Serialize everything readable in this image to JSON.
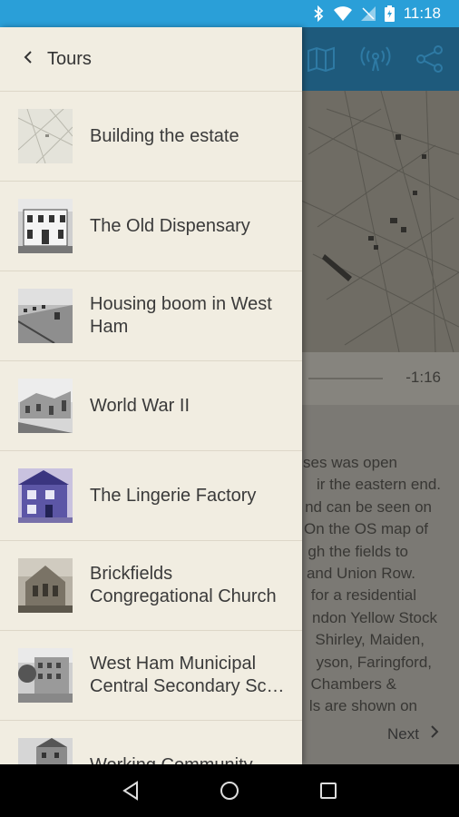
{
  "status_bar": {
    "time": "11:18"
  },
  "drawer": {
    "back_label": "Tours",
    "items": [
      {
        "title": "Building the estate"
      },
      {
        "title": "The Old Dispensary"
      },
      {
        "title": "Housing boom in West Ham"
      },
      {
        "title": "World War II"
      },
      {
        "title": "The Lingerie Factory"
      },
      {
        "title": "Brickfields Congregational Church"
      },
      {
        "title": "West Ham Municipal Central Secondary Sc…"
      },
      {
        "title": "Working Community"
      }
    ]
  },
  "player": {
    "time_remaining": "-1:16"
  },
  "article": {
    "lines": [
      "ses was open",
      "ir the eastern end.",
      "nd can be seen on",
      "On the OS map of",
      "gh the fields to",
      "and Union Row.",
      "for a residential",
      "ndon Yellow Stock",
      "Shirley, Maiden,",
      "yson, Faringford,",
      "Chambers &",
      "ls are shown on"
    ]
  },
  "next_label": "Next"
}
